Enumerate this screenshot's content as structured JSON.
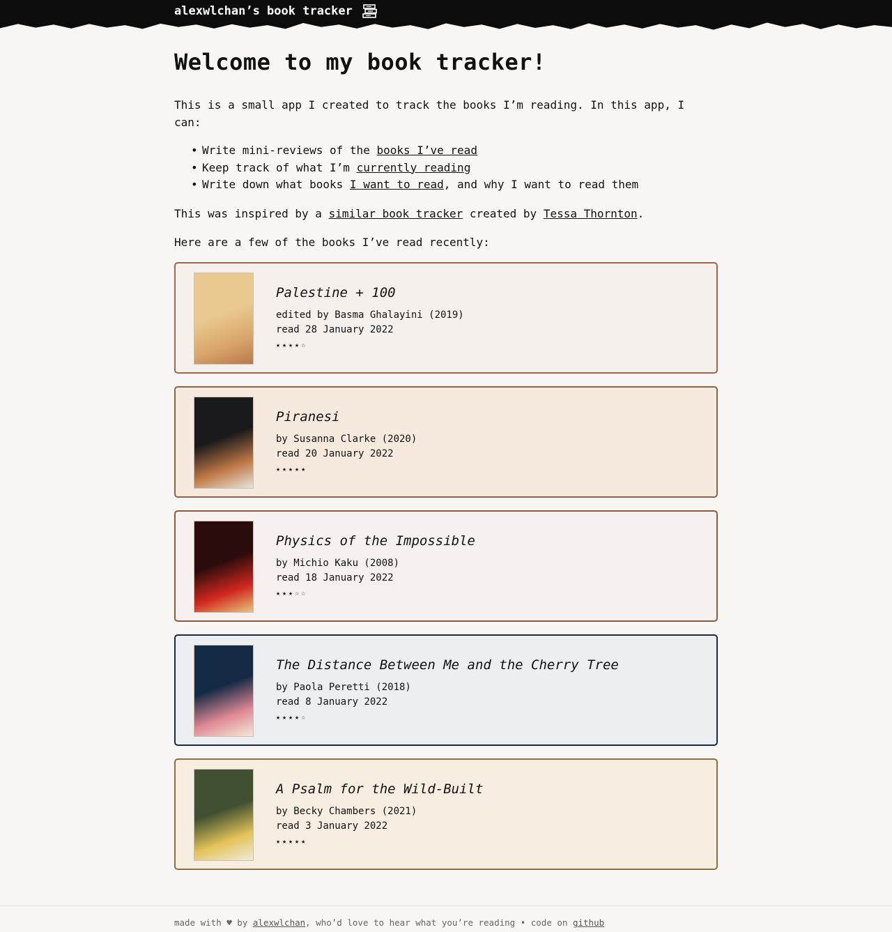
{
  "header": {
    "site_title": "alexwlchan’s book tracker",
    "icon": "books-icon"
  },
  "main": {
    "heading": "Welcome to my book tracker!",
    "intro": "This is a small app I created to track the books I’m reading. In this app, I can:",
    "features": [
      {
        "before": "Write mini-reviews of the ",
        "link": "books I’ve read",
        "after": ""
      },
      {
        "before": "Keep track of what I’m ",
        "link": "currently reading",
        "after": ""
      },
      {
        "before": "Write down what books ",
        "link": "I want to read",
        "after": ", and why I want to read them"
      }
    ],
    "inspired_before": "This was inspired by a ",
    "inspired_link": "similar book tracker",
    "inspired_middle": " created by ",
    "inspired_author": "Tessa Thornton",
    "inspired_after": ".",
    "recent_intro": "Here are a few of the books I’ve read recently:"
  },
  "books": [
    {
      "title": "Palestine + 100",
      "byline": "edited by Basma Ghalayini (2019)",
      "read": "read 28 January 2022",
      "stars": "★★★★☆",
      "border": "#a0684a",
      "bg": "#f6f0ec",
      "cover_colors": [
        "#e9c98f",
        "#d8a56a",
        "#b8794a"
      ]
    },
    {
      "title": "Piranesi",
      "byline": "by Susanna Clarke (2020)",
      "read": "read 20 January 2022",
      "stars": "★★★★★",
      "border": "#8a6444",
      "bg": "#f6e9de",
      "cover_colors": [
        "#1a1a1c",
        "#c17a47",
        "#e8e4dc"
      ]
    },
    {
      "title": "Physics of the Impossible",
      "byline": "by Michio Kaku (2008)",
      "read": "read 18 January 2022",
      "stars": "★★★☆☆",
      "border": "#8a5c3c",
      "bg": "#f6f1ef",
      "cover_colors": [
        "#2a0c0c",
        "#d1281f",
        "#e9c57d"
      ]
    },
    {
      "title": "The Distance Between Me and the Cherry Tree",
      "byline": "by Paola Peretti (2018)",
      "read": "read 8 January 2022",
      "stars": "★★★★☆",
      "border": "#1a2a44",
      "bg": "#eceef1",
      "cover_colors": [
        "#142a44",
        "#e08a96",
        "#f4e9d8"
      ]
    },
    {
      "title": "A Psalm for the Wild-Built",
      "byline": "by Becky Chambers (2021)",
      "read": "read 3 January 2022",
      "stars": "★★★★★",
      "border": "#8a7040",
      "bg": "#f7ede0",
      "cover_colors": [
        "#3e5030",
        "#e4c35a",
        "#f0ebd8"
      ]
    }
  ],
  "footer": {
    "made_with": "made with ♥ by ",
    "author_link": "alexwlchan",
    "middle": ", who’d love to hear what you’re reading • code on ",
    "github_link": "github"
  }
}
